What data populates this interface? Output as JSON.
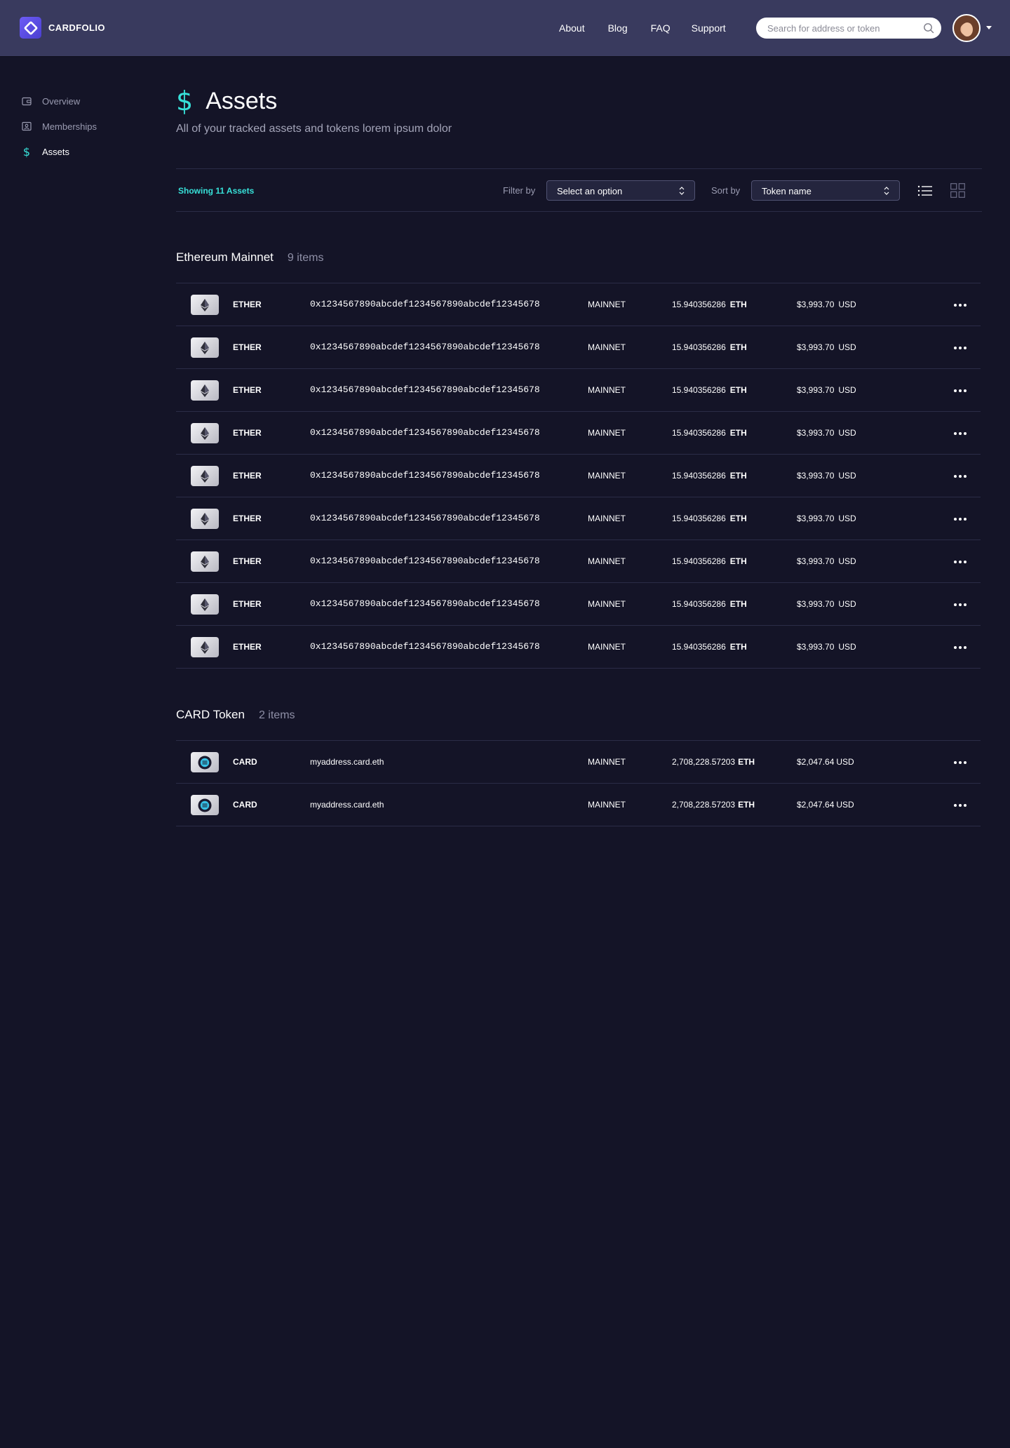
{
  "app": {
    "brand": "CARDFOLIO"
  },
  "nav": {
    "items": [
      "About",
      "Blog",
      "FAQ",
      "Support"
    ]
  },
  "search": {
    "placeholder": "Search for address or token"
  },
  "sidebar": {
    "items": [
      {
        "label": "Overview",
        "icon": "wallet-icon",
        "active": false
      },
      {
        "label": "Memberships",
        "icon": "id-card-icon",
        "active": false
      },
      {
        "label": "Assets",
        "icon": "dollar-icon",
        "active": true
      }
    ]
  },
  "page": {
    "title_icon": "$",
    "title": "Assets",
    "subtitle": "All of your tracked assets and tokens lorem ipsum dolor"
  },
  "toolbar": {
    "showing": "Showing 11 Assets",
    "filter_label": "Filter by",
    "filter_value": "Select an option",
    "sort_label": "Sort by",
    "sort_value": "Token name"
  },
  "groups": [
    {
      "name": "Ethereum Mainnet",
      "count": "9 items",
      "rows": [
        {
          "token": "ETHER",
          "address": "0x1234567890abcdef1234567890abcdef12345678",
          "network": "MAINNET",
          "balance": "15.940356286",
          "unit": "ETH",
          "usd": "$3,993.70",
          "currency": "USD"
        },
        {
          "token": "ETHER",
          "address": "0x1234567890abcdef1234567890abcdef12345678",
          "network": "MAINNET",
          "balance": "15.940356286",
          "unit": "ETH",
          "usd": "$3,993.70",
          "currency": "USD"
        },
        {
          "token": "ETHER",
          "address": "0x1234567890abcdef1234567890abcdef12345678",
          "network": "MAINNET",
          "balance": "15.940356286",
          "unit": "ETH",
          "usd": "$3,993.70",
          "currency": "USD"
        },
        {
          "token": "ETHER",
          "address": "0x1234567890abcdef1234567890abcdef12345678",
          "network": "MAINNET",
          "balance": "15.940356286",
          "unit": "ETH",
          "usd": "$3,993.70",
          "currency": "USD"
        },
        {
          "token": "ETHER",
          "address": "0x1234567890abcdef1234567890abcdef12345678",
          "network": "MAINNET",
          "balance": "15.940356286",
          "unit": "ETH",
          "usd": "$3,993.70",
          "currency": "USD"
        },
        {
          "token": "ETHER",
          "address": "0x1234567890abcdef1234567890abcdef12345678",
          "network": "MAINNET",
          "balance": "15.940356286",
          "unit": "ETH",
          "usd": "$3,993.70",
          "currency": "USD"
        },
        {
          "token": "ETHER",
          "address": "0x1234567890abcdef1234567890abcdef12345678",
          "network": "MAINNET",
          "balance": "15.940356286",
          "unit": "ETH",
          "usd": "$3,993.70",
          "currency": "USD"
        },
        {
          "token": "ETHER",
          "address": "0x1234567890abcdef1234567890abcdef12345678",
          "network": "MAINNET",
          "balance": "15.940356286",
          "unit": "ETH",
          "usd": "$3,993.70",
          "currency": "USD"
        },
        {
          "token": "ETHER",
          "address": "0x1234567890abcdef1234567890abcdef12345678",
          "network": "MAINNET",
          "balance": "15.940356286",
          "unit": "ETH",
          "usd": "$3,993.70",
          "currency": "USD"
        }
      ]
    },
    {
      "name": "CARD Token",
      "count": "2 items",
      "rows": [
        {
          "token": "CARD",
          "address": "myaddress.card.eth",
          "network": "MAINNET",
          "balance": "2,708,228.57203",
          "unit": "ETH",
          "usd": "$2,047.64",
          "currency": "USD"
        },
        {
          "token": "CARD",
          "address": "myaddress.card.eth",
          "network": "MAINNET",
          "balance": "2,708,228.57203",
          "unit": "ETH",
          "usd": "$2,047.64",
          "currency": "USD"
        }
      ]
    }
  ],
  "colors": {
    "accent": "#37e0d8",
    "background": "#141427",
    "header": "#393a5e"
  }
}
